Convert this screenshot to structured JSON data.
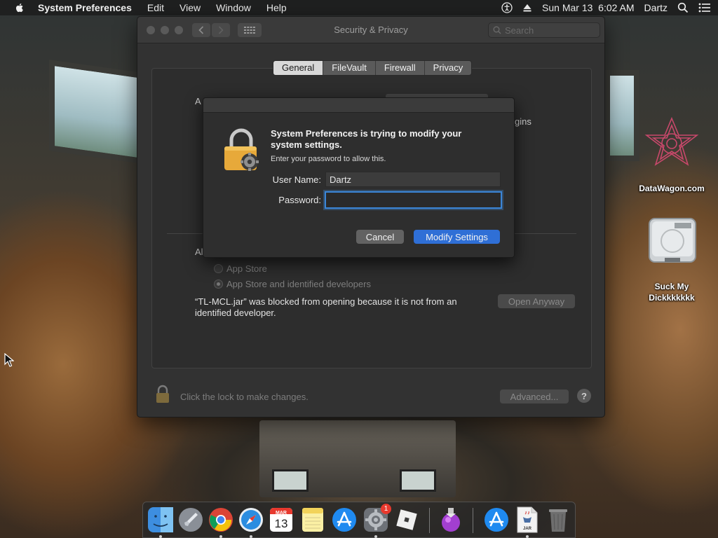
{
  "menubar": {
    "app_name": "System Preferences",
    "items": [
      "Edit",
      "View",
      "Window",
      "Help"
    ],
    "datetime": "Sun Mar 13  6:02 AM",
    "user": "Dartz"
  },
  "window": {
    "title": "Security & Privacy",
    "search_placeholder": "Search",
    "tabs": [
      {
        "label": "General",
        "active": true
      },
      {
        "label": "FileVault",
        "active": false
      },
      {
        "label": "Firewall",
        "active": false
      },
      {
        "label": "Privacy",
        "active": false
      }
    ],
    "partial_text_a": "A",
    "partial_text_gins": "gins",
    "partial_text_al": "Al",
    "radio_options": [
      {
        "label": "App Store",
        "selected": false
      },
      {
        "label": "App Store and identified developers",
        "selected": true
      }
    ],
    "blocked_message_line1": "“TL-MCL.jar” was blocked from opening because it is not from an",
    "blocked_message_line2": "identified developer.",
    "open_anyway_label": "Open Anyway",
    "lock_message": "Click the lock to make changes.",
    "advanced_label": "Advanced...",
    "help_label": "?"
  },
  "dialog": {
    "title": "System Preferences is trying to modify your system settings.",
    "subtitle": "Enter your password to allow this.",
    "username_label": "User Name:",
    "username_value": "Dartz",
    "password_label": "Password:",
    "password_value": "",
    "cancel_label": "Cancel",
    "confirm_label": "Modify Settings"
  },
  "desktop": {
    "icon1_label": "DataWagon.com",
    "icon2_label_line1": "Suck My",
    "icon2_label_line2": "Dickkkkkkk"
  },
  "dock": {
    "calendar_month": "MAR",
    "calendar_day": "13",
    "prefs_badge": "1",
    "jar_label": "JAR"
  },
  "colors": {
    "accent": "#2f6fd6",
    "focus_ring": "#3b86d8",
    "badge": "#e8392e"
  }
}
